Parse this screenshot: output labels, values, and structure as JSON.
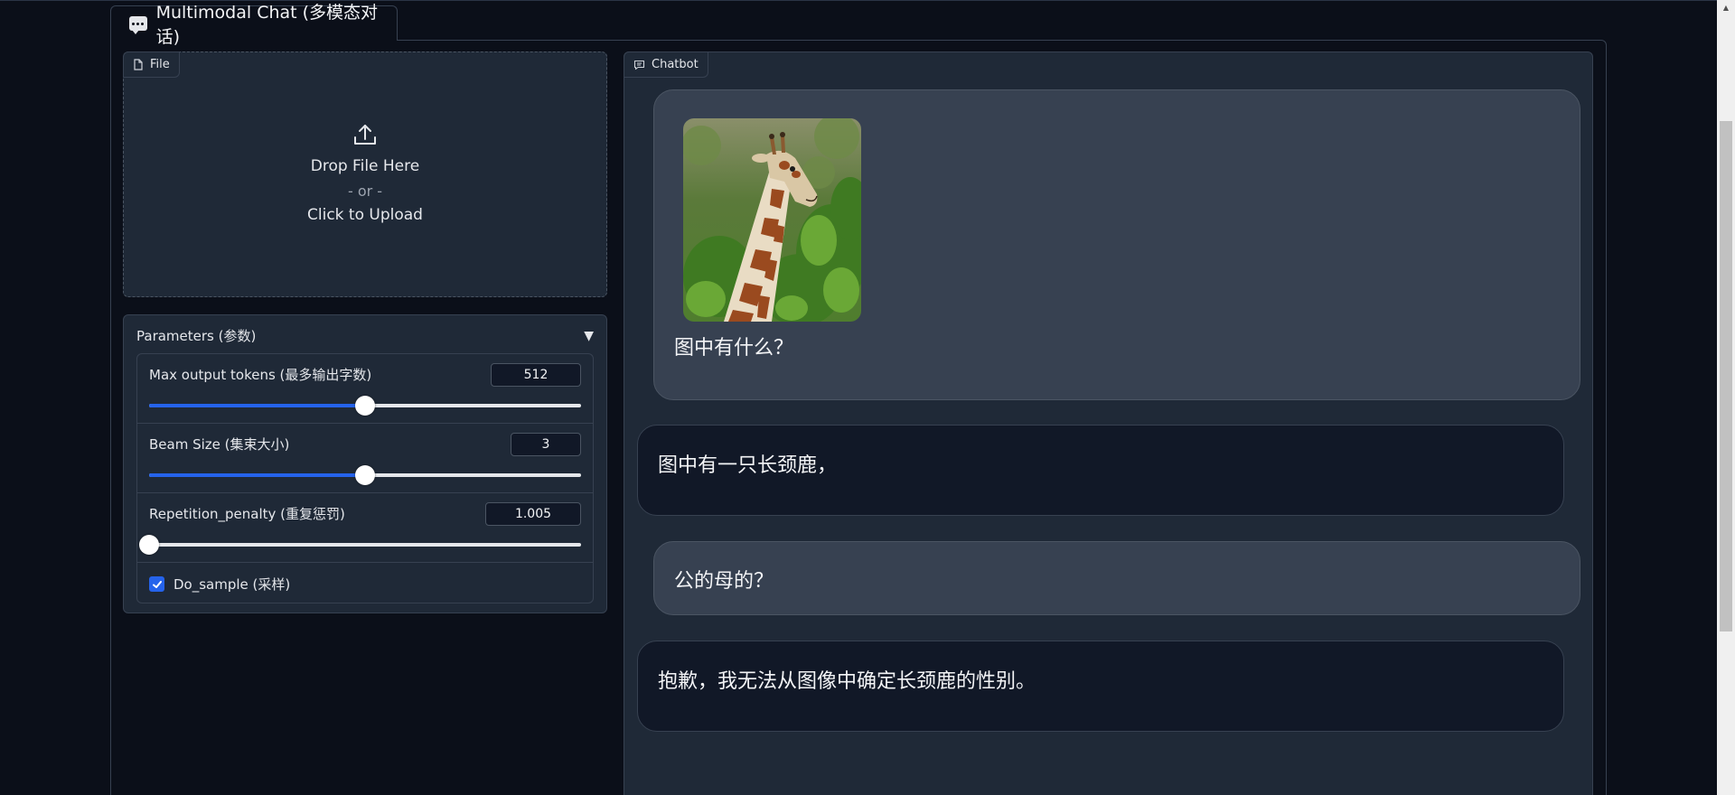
{
  "tab": {
    "label": "Multimodal Chat (多模态对话)",
    "icon": "chat-bubble-icon"
  },
  "file": {
    "label": "File",
    "icon": "file-icon",
    "upload_icon": "upload-icon",
    "drop_text": "Drop File Here",
    "or_text": "- or -",
    "click_text": "Click to Upload"
  },
  "params": {
    "title": "Parameters (参数)",
    "max_tokens": {
      "label": "Max output tokens (最多输出字数)",
      "value": "512",
      "fraction": 0.5
    },
    "beam_size": {
      "label": "Beam Size (集束大小)",
      "value": "3",
      "fraction": 0.5
    },
    "repetition": {
      "label": "Repetition_penalty (重复惩罚)",
      "value": "1.005",
      "fraction": 0.0
    },
    "do_sample": {
      "label": "Do_sample (采样)",
      "checked": true
    }
  },
  "chatbot": {
    "label": "Chatbot",
    "icon": "chat-icon",
    "messages": [
      {
        "role": "user",
        "image": "giraffe-photo",
        "text": "图中有什么？"
      },
      {
        "role": "bot",
        "text": "图中有一只长颈鹿，"
      },
      {
        "role": "user",
        "text": "公的母的？"
      },
      {
        "role": "bot",
        "text": "抱歉，我无法从图像中确定长颈鹿的性别。"
      }
    ]
  },
  "colors": {
    "accent": "#2563eb",
    "background": "#0b0f19",
    "panel": "#1f2937",
    "user_bubble": "#374151",
    "bot_bubble": "#111827"
  }
}
